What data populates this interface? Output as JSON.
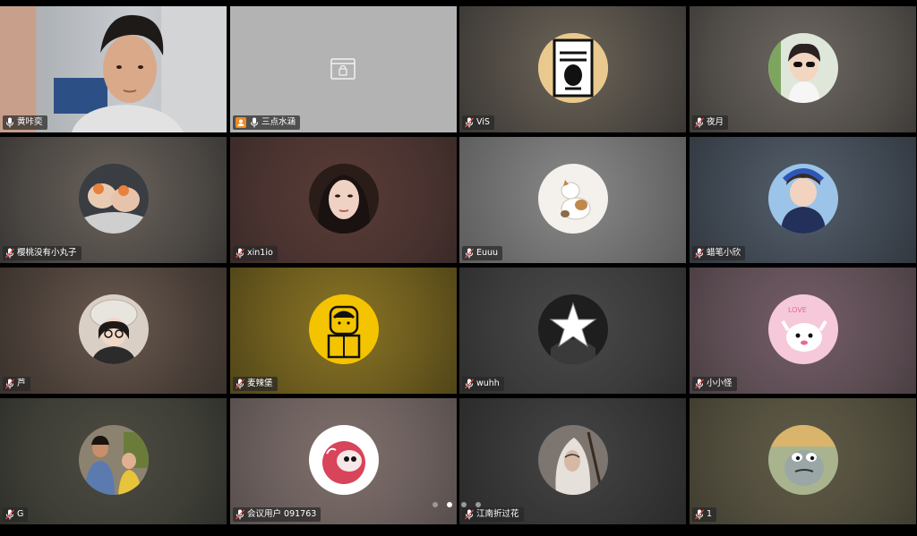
{
  "participants": [
    {
      "name": "黄咔奕",
      "kind": "camera",
      "bg": "#b9bcc1",
      "muted": false
    },
    {
      "name": "三点水涵",
      "kind": "locked",
      "bg": "#b3b3b3",
      "host": true,
      "active": true,
      "muted": false
    },
    {
      "name": "ViS",
      "kind": "avatar",
      "bg": "#5a5348",
      "avatar_bg": "#e9c98e",
      "muted": true
    },
    {
      "name": "夜月",
      "kind": "avatar",
      "bg": "#54504c",
      "avatar_bg": "#dfe6da",
      "muted": true
    },
    {
      "name": "樱桃没有小丸子",
      "kind": "avatar",
      "bg": "#4c4a48",
      "avatar_bg": "#3a3d42",
      "muted": true
    },
    {
      "name": "xin1io",
      "kind": "avatar",
      "bg": "#4a3330",
      "avatar_bg": "#2a1c19",
      "muted": true
    },
    {
      "name": "Euuu",
      "kind": "avatar",
      "bg": "#6e6e6e",
      "avatar_bg": "#f4f1ec",
      "muted": true
    },
    {
      "name": "蜡笔小欣",
      "kind": "avatar",
      "bg": "#3e4650",
      "avatar_bg": "#9cc4e8",
      "muted": true
    },
    {
      "name": "芦",
      "kind": "avatar",
      "bg": "#4a3f38",
      "avatar_bg": "#d9cfc4",
      "muted": true
    },
    {
      "name": "麦辣堡",
      "kind": "avatar",
      "bg": "#6a5a1e",
      "avatar_bg": "#f5c400",
      "muted": true
    },
    {
      "name": "wuhh",
      "kind": "avatar",
      "bg": "#3b3b3b",
      "avatar_bg": "#1e1e1e",
      "muted": true
    },
    {
      "name": "小小怪",
      "kind": "avatar",
      "bg": "#5b4c52",
      "avatar_bg": "#f5c9da",
      "muted": true
    },
    {
      "name": "G",
      "kind": "avatar",
      "bg": "#3d3d36",
      "avatar_bg": "#8c8270",
      "muted": true
    },
    {
      "name": "会议用户 091763",
      "kind": "avatar",
      "bg": "#6a5e5c",
      "avatar_bg": "#ffffff",
      "muted": true
    },
    {
      "name": "江南折过花",
      "kind": "avatar",
      "bg": "#353535",
      "avatar_bg": "#7c7570",
      "muted": true
    },
    {
      "name": "1",
      "kind": "avatar",
      "bg": "#4e4a3a",
      "avatar_bg": "#a9b48f",
      "muted": true
    }
  ],
  "pagination": {
    "total": 4,
    "current": 2
  },
  "colors": {
    "active_border": "#1ca85a",
    "host_badge": "#f08a24"
  }
}
